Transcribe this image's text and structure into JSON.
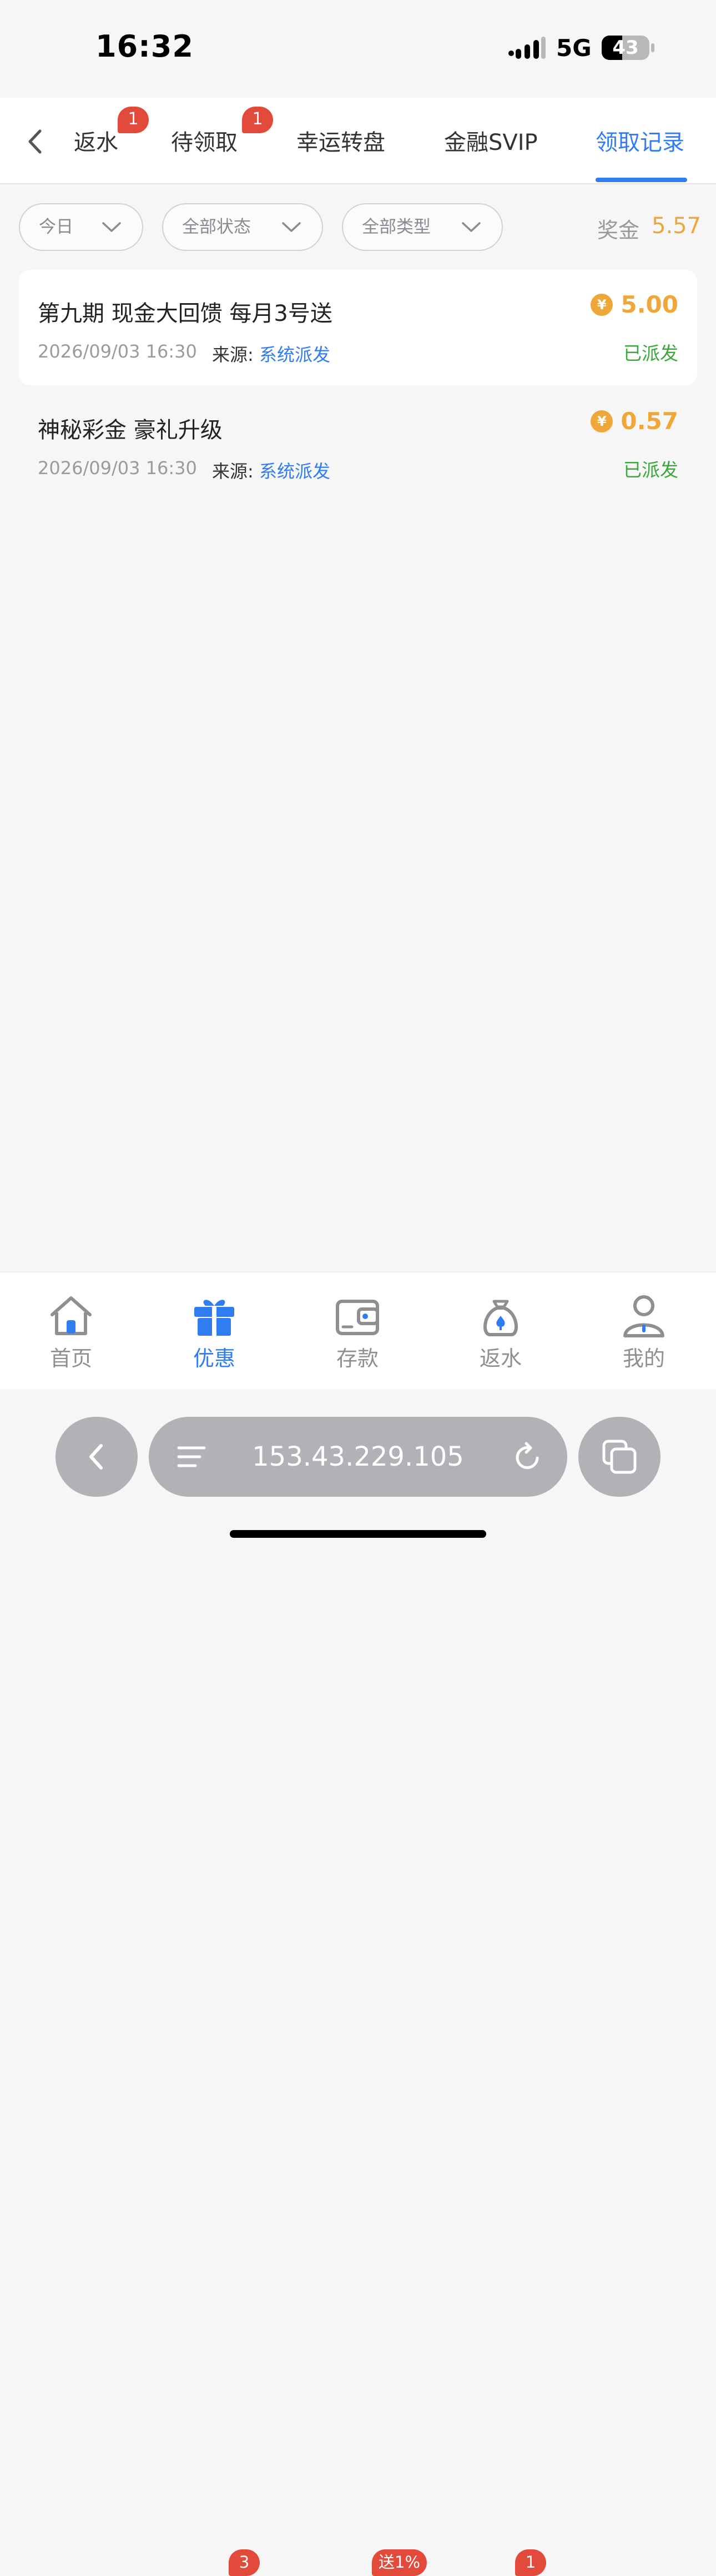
{
  "status_bar": {
    "time": "16:32",
    "network": "5G",
    "battery": "43",
    "battery_level": 0.43
  },
  "tabs": [
    {
      "label": "返水",
      "badge": "1"
    },
    {
      "label": "待领取",
      "badge": "1"
    },
    {
      "label": "幸运转盘"
    },
    {
      "label": "金融SVIP"
    },
    {
      "label": "领取记录",
      "active": true
    }
  ],
  "filters": {
    "date": "今日",
    "status": "全部状态",
    "type": "全部类型"
  },
  "bonus": {
    "label": "奖金",
    "value": "5.57"
  },
  "records": [
    {
      "title": "第九期 现金大回馈 每月3号送",
      "time": "2026/09/03 16:30",
      "source_label": "来源:",
      "source_value": "系统派发",
      "amount": "5.00",
      "currency_icon": "¥",
      "status": "已派发"
    },
    {
      "title": "神秘彩金 豪礼升级",
      "time": "2026/09/03 16:30",
      "source_label": "来源:",
      "source_value": "系统派发",
      "amount": "0.57",
      "currency_icon": "¥",
      "status": "已派发"
    }
  ],
  "bottom_nav": [
    {
      "label": "首页",
      "icon": "home-icon"
    },
    {
      "label": "优惠",
      "icon": "gift-icon",
      "badge": "3",
      "active": true
    },
    {
      "label": "存款",
      "icon": "wallet-icon",
      "badge": "送1%"
    },
    {
      "label": "返水",
      "icon": "money-bag-icon",
      "badge": "1"
    },
    {
      "label": "我的",
      "icon": "user-icon"
    }
  ],
  "browser": {
    "url": "153.43.229.105"
  },
  "colors": {
    "accent": "#2f7df0",
    "badge": "#e24a3b",
    "gold": "#f0a73a",
    "success": "#3aa83a"
  }
}
